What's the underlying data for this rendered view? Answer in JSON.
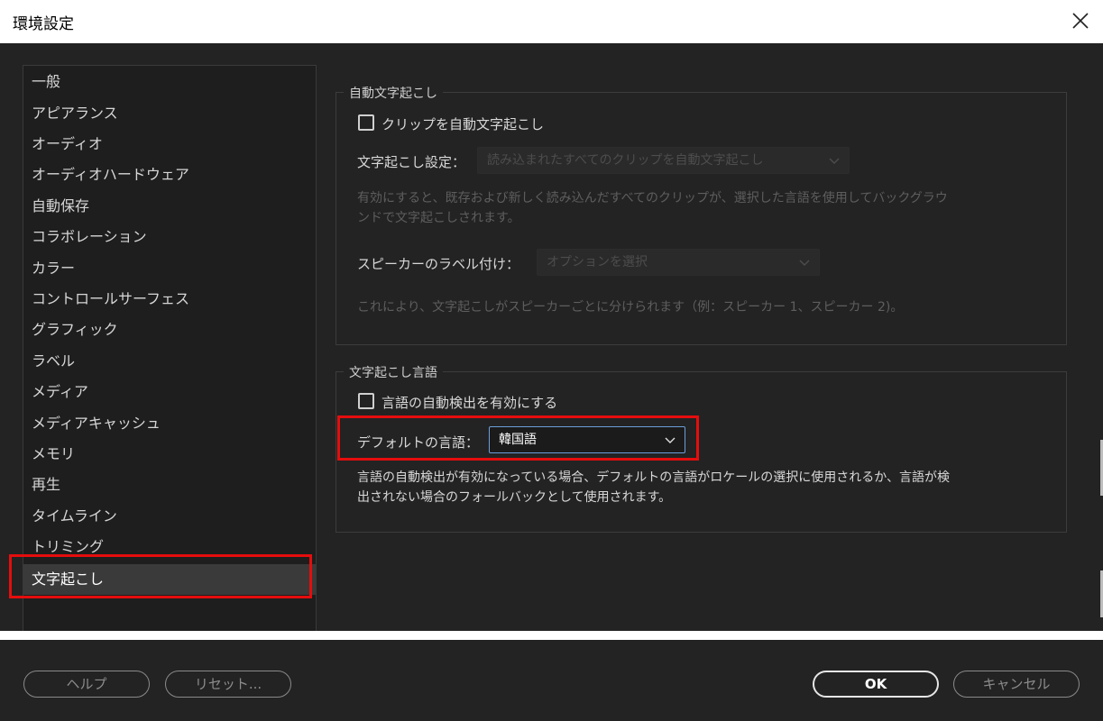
{
  "window": {
    "title": "環境設定"
  },
  "sidebar": {
    "items": [
      {
        "label": "一般"
      },
      {
        "label": "アピアランス"
      },
      {
        "label": "オーディオ"
      },
      {
        "label": "オーディオハードウェア"
      },
      {
        "label": "自動保存"
      },
      {
        "label": "コラボレーション"
      },
      {
        "label": "カラー"
      },
      {
        "label": "コントロールサーフェス"
      },
      {
        "label": "グラフィック"
      },
      {
        "label": "ラベル"
      },
      {
        "label": "メディア"
      },
      {
        "label": "メディアキャッシュ"
      },
      {
        "label": "メモリ"
      },
      {
        "label": "再生"
      },
      {
        "label": "タイムライン"
      },
      {
        "label": "トリミング"
      },
      {
        "label": "文字起こし"
      }
    ],
    "selected_item": "文字起こし"
  },
  "auto_transcription": {
    "legend": "自動文字起こし",
    "checkbox_label": "クリップを自動文字起こし",
    "checkbox_checked": false,
    "setting_label": "文字起こし設定：",
    "setting_value": "読み込まれたすべてのクリップを自動文字起こし",
    "description": "有効にすると、既存および新しく読み込んだすべてのクリップが、選択した言語を使用してバックグラウンドで文字起こしされます。",
    "speaker_label": "スピーカーのラベル付け：",
    "speaker_value": "オプションを選択",
    "speaker_description": "これにより、文字起こしがスピーカーごとに分けられます（例：スピーカー 1、スピーカー 2)。"
  },
  "transcription_language": {
    "legend": "文字起こし言語",
    "checkbox_label": "言語の自動検出を有効にする",
    "checkbox_checked": false,
    "default_label": "デフォルトの言語：",
    "default_value": "韓国語",
    "description": "言語の自動検出が有効になっている場合、デフォルトの言語がロケールの選択に使用されるか、言語が検出されない場合のフォールバックとして使用されます。"
  },
  "footer": {
    "help_label": "ヘルプ",
    "reset_label": "リセット...",
    "ok_label": "OK",
    "cancel_label": "キャンセル"
  },
  "colors": {
    "panel_bg": "#232323",
    "highlight": "#e50d0d",
    "dropdown_focus": "#6c9fd8"
  },
  "icons": [
    "close-icon",
    "chevron-down-icon"
  ]
}
